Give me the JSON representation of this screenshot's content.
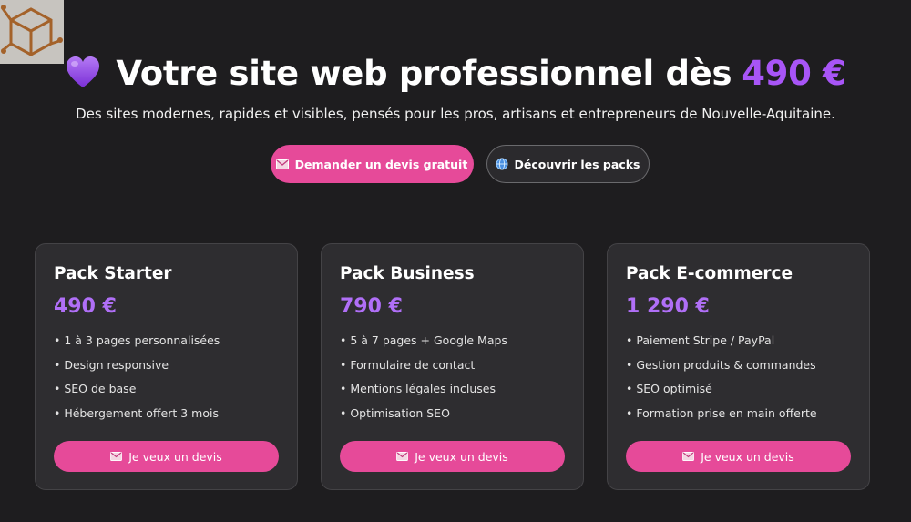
{
  "hero": {
    "title": "Votre site web professionnel dès",
    "price": "490 €",
    "subtitle": "Des sites modernes, rapides et visibles, pensés pour les pros, artisans et entrepreneurs de Nouvelle-Aquitaine."
  },
  "cta": {
    "primary_label": "Demander un devis gratuit",
    "secondary_label": "Découvrir les packs"
  },
  "icons": {
    "logo": "cube-logo-icon",
    "heart": "purple-heart-icon",
    "mail": "envelope-icon",
    "globe": "globe-icon"
  },
  "colors": {
    "accent_pink": "#e64a99",
    "accent_purple": "#a855f7",
    "background": "#1e1d1f",
    "card": "#2e2d30"
  },
  "packs": [
    {
      "name": "Pack Starter",
      "price": "490 €",
      "features": [
        "• 1 à 3 pages personnalisées",
        "• Design responsive",
        "• SEO de base",
        "• Hébergement offert 3 mois"
      ],
      "button_label": "Je veux un devis"
    },
    {
      "name": "Pack Business",
      "price": "790 €",
      "features": [
        "• 5 à 7 pages + Google Maps",
        "• Formulaire de contact",
        "• Mentions légales incluses",
        "• Optimisation SEO"
      ],
      "button_label": "Je veux un devis"
    },
    {
      "name": "Pack E-commerce",
      "price": "1 290 €",
      "features": [
        "• Paiement Stripe / PayPal",
        "• Gestion produits & commandes",
        "• SEO optimisé",
        "• Formation prise en main offerte"
      ],
      "button_label": "Je veux un devis"
    }
  ]
}
